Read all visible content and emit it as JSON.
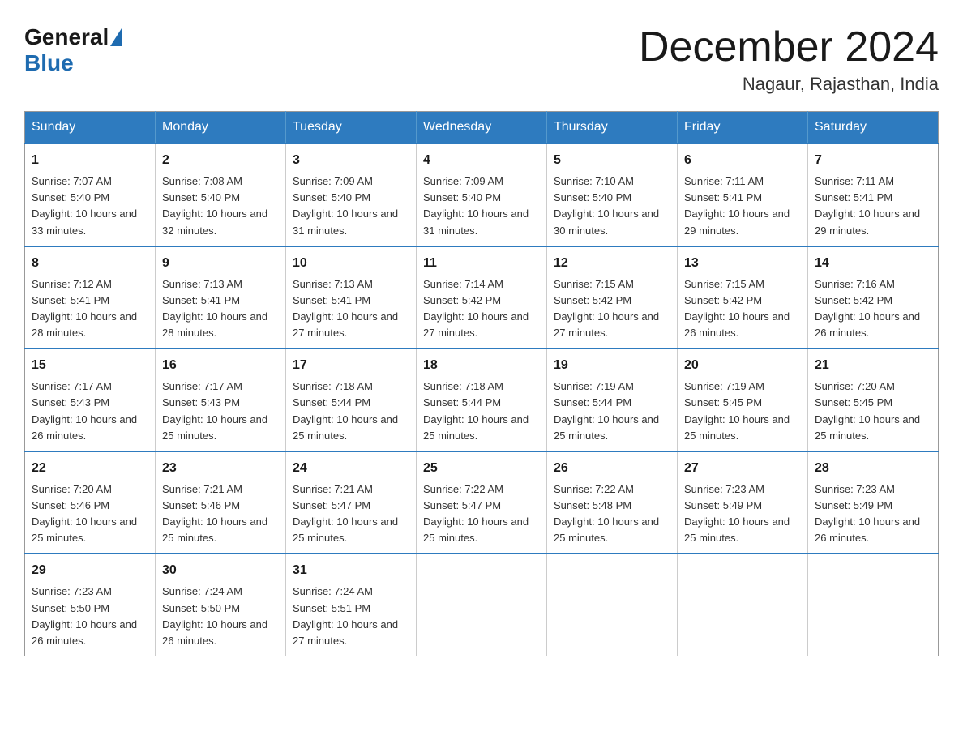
{
  "logo": {
    "general": "General",
    "blue": "Blue"
  },
  "header": {
    "month": "December 2024",
    "location": "Nagaur, Rajasthan, India"
  },
  "days_of_week": [
    "Sunday",
    "Monday",
    "Tuesday",
    "Wednesday",
    "Thursday",
    "Friday",
    "Saturday"
  ],
  "weeks": [
    [
      {
        "day": "1",
        "sunrise": "7:07 AM",
        "sunset": "5:40 PM",
        "daylight": "10 hours and 33 minutes."
      },
      {
        "day": "2",
        "sunrise": "7:08 AM",
        "sunset": "5:40 PM",
        "daylight": "10 hours and 32 minutes."
      },
      {
        "day": "3",
        "sunrise": "7:09 AM",
        "sunset": "5:40 PM",
        "daylight": "10 hours and 31 minutes."
      },
      {
        "day": "4",
        "sunrise": "7:09 AM",
        "sunset": "5:40 PM",
        "daylight": "10 hours and 31 minutes."
      },
      {
        "day": "5",
        "sunrise": "7:10 AM",
        "sunset": "5:40 PM",
        "daylight": "10 hours and 30 minutes."
      },
      {
        "day": "6",
        "sunrise": "7:11 AM",
        "sunset": "5:41 PM",
        "daylight": "10 hours and 29 minutes."
      },
      {
        "day": "7",
        "sunrise": "7:11 AM",
        "sunset": "5:41 PM",
        "daylight": "10 hours and 29 minutes."
      }
    ],
    [
      {
        "day": "8",
        "sunrise": "7:12 AM",
        "sunset": "5:41 PM",
        "daylight": "10 hours and 28 minutes."
      },
      {
        "day": "9",
        "sunrise": "7:13 AM",
        "sunset": "5:41 PM",
        "daylight": "10 hours and 28 minutes."
      },
      {
        "day": "10",
        "sunrise": "7:13 AM",
        "sunset": "5:41 PM",
        "daylight": "10 hours and 27 minutes."
      },
      {
        "day": "11",
        "sunrise": "7:14 AM",
        "sunset": "5:42 PM",
        "daylight": "10 hours and 27 minutes."
      },
      {
        "day": "12",
        "sunrise": "7:15 AM",
        "sunset": "5:42 PM",
        "daylight": "10 hours and 27 minutes."
      },
      {
        "day": "13",
        "sunrise": "7:15 AM",
        "sunset": "5:42 PM",
        "daylight": "10 hours and 26 minutes."
      },
      {
        "day": "14",
        "sunrise": "7:16 AM",
        "sunset": "5:42 PM",
        "daylight": "10 hours and 26 minutes."
      }
    ],
    [
      {
        "day": "15",
        "sunrise": "7:17 AM",
        "sunset": "5:43 PM",
        "daylight": "10 hours and 26 minutes."
      },
      {
        "day": "16",
        "sunrise": "7:17 AM",
        "sunset": "5:43 PM",
        "daylight": "10 hours and 25 minutes."
      },
      {
        "day": "17",
        "sunrise": "7:18 AM",
        "sunset": "5:44 PM",
        "daylight": "10 hours and 25 minutes."
      },
      {
        "day": "18",
        "sunrise": "7:18 AM",
        "sunset": "5:44 PM",
        "daylight": "10 hours and 25 minutes."
      },
      {
        "day": "19",
        "sunrise": "7:19 AM",
        "sunset": "5:44 PM",
        "daylight": "10 hours and 25 minutes."
      },
      {
        "day": "20",
        "sunrise": "7:19 AM",
        "sunset": "5:45 PM",
        "daylight": "10 hours and 25 minutes."
      },
      {
        "day": "21",
        "sunrise": "7:20 AM",
        "sunset": "5:45 PM",
        "daylight": "10 hours and 25 minutes."
      }
    ],
    [
      {
        "day": "22",
        "sunrise": "7:20 AM",
        "sunset": "5:46 PM",
        "daylight": "10 hours and 25 minutes."
      },
      {
        "day": "23",
        "sunrise": "7:21 AM",
        "sunset": "5:46 PM",
        "daylight": "10 hours and 25 minutes."
      },
      {
        "day": "24",
        "sunrise": "7:21 AM",
        "sunset": "5:47 PM",
        "daylight": "10 hours and 25 minutes."
      },
      {
        "day": "25",
        "sunrise": "7:22 AM",
        "sunset": "5:47 PM",
        "daylight": "10 hours and 25 minutes."
      },
      {
        "day": "26",
        "sunrise": "7:22 AM",
        "sunset": "5:48 PM",
        "daylight": "10 hours and 25 minutes."
      },
      {
        "day": "27",
        "sunrise": "7:23 AM",
        "sunset": "5:49 PM",
        "daylight": "10 hours and 25 minutes."
      },
      {
        "day": "28",
        "sunrise": "7:23 AM",
        "sunset": "5:49 PM",
        "daylight": "10 hours and 26 minutes."
      }
    ],
    [
      {
        "day": "29",
        "sunrise": "7:23 AM",
        "sunset": "5:50 PM",
        "daylight": "10 hours and 26 minutes."
      },
      {
        "day": "30",
        "sunrise": "7:24 AM",
        "sunset": "5:50 PM",
        "daylight": "10 hours and 26 minutes."
      },
      {
        "day": "31",
        "sunrise": "7:24 AM",
        "sunset": "5:51 PM",
        "daylight": "10 hours and 27 minutes."
      },
      null,
      null,
      null,
      null
    ]
  ]
}
